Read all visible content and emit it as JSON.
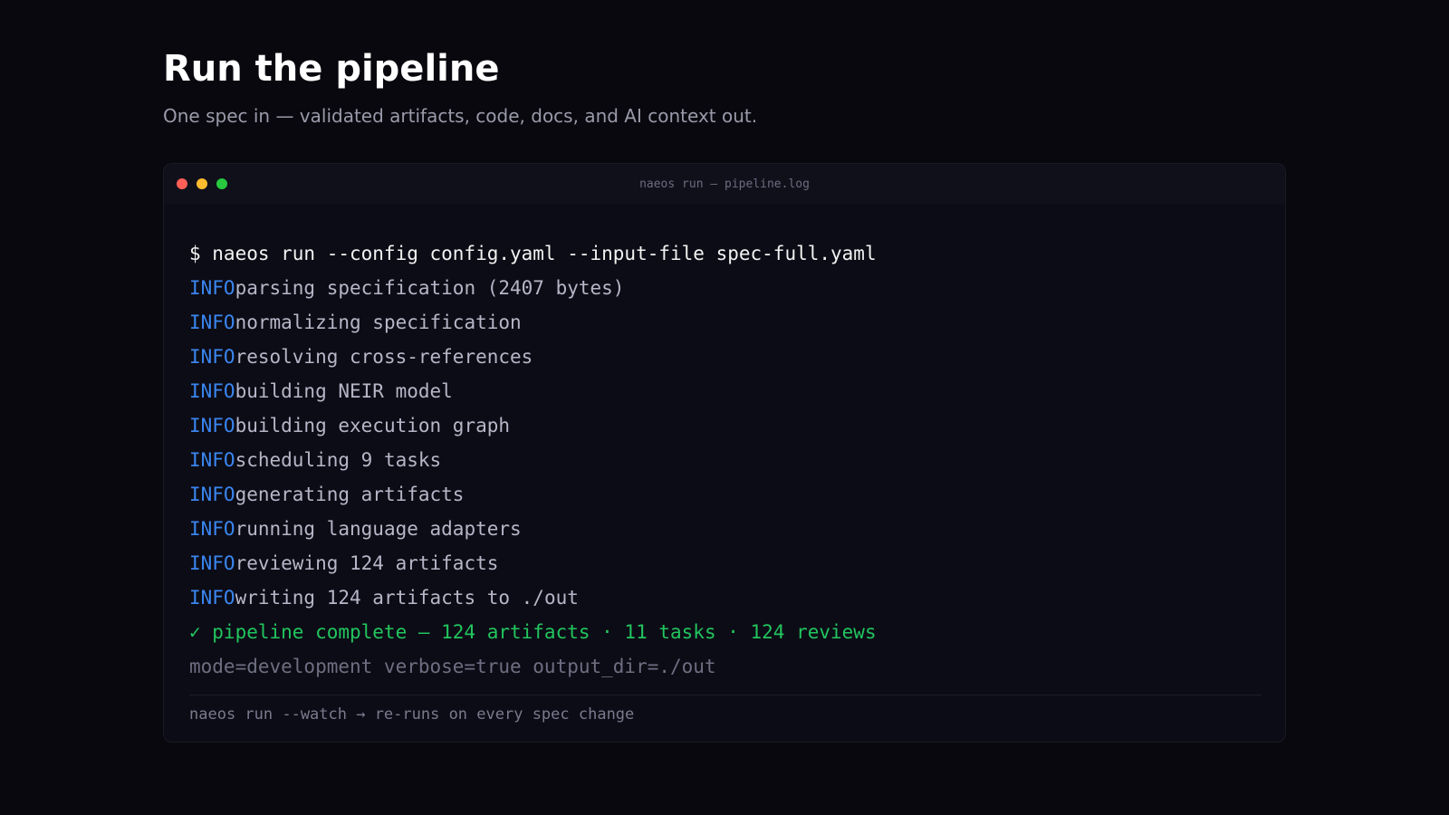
{
  "header": {
    "title": "Run the pipeline",
    "subtitle": "One spec in — validated artifacts, code, docs, and AI context out."
  },
  "terminal": {
    "window_title": "naeos run — pipeline.log",
    "traffic_lights": {
      "close_color": "#ff5f57",
      "minimize_color": "#febc2e",
      "maximize_color": "#28c840"
    },
    "command": "$ naeos run --config config.yaml --input-file spec-full.yaml",
    "logs": [
      {
        "level": "INFO",
        "message": "parsing specification (2407 bytes)"
      },
      {
        "level": "INFO",
        "message": "normalizing specification"
      },
      {
        "level": "INFO",
        "message": "resolving cross-references"
      },
      {
        "level": "INFO",
        "message": "building NEIR model"
      },
      {
        "level": "INFO",
        "message": "building execution graph"
      },
      {
        "level": "INFO",
        "message": "scheduling 9 tasks"
      },
      {
        "level": "INFO",
        "message": "generating artifacts"
      },
      {
        "level": "INFO",
        "message": "running language adapters"
      },
      {
        "level": "INFO",
        "message": "reviewing 124 artifacts"
      },
      {
        "level": "INFO",
        "message": "writing 124 artifacts to ./out"
      }
    ],
    "success": "✓ pipeline complete — 124 artifacts · 11 tasks · 124 reviews",
    "meta": "mode=development verbose=true output_dir=./out",
    "footer_hint": "naeos run --watch → re-runs on every spec change"
  },
  "colors": {
    "background": "#08080e",
    "terminal_bg": "#0c0c16",
    "info_accent": "#3a86f0",
    "success": "#22c55e"
  }
}
